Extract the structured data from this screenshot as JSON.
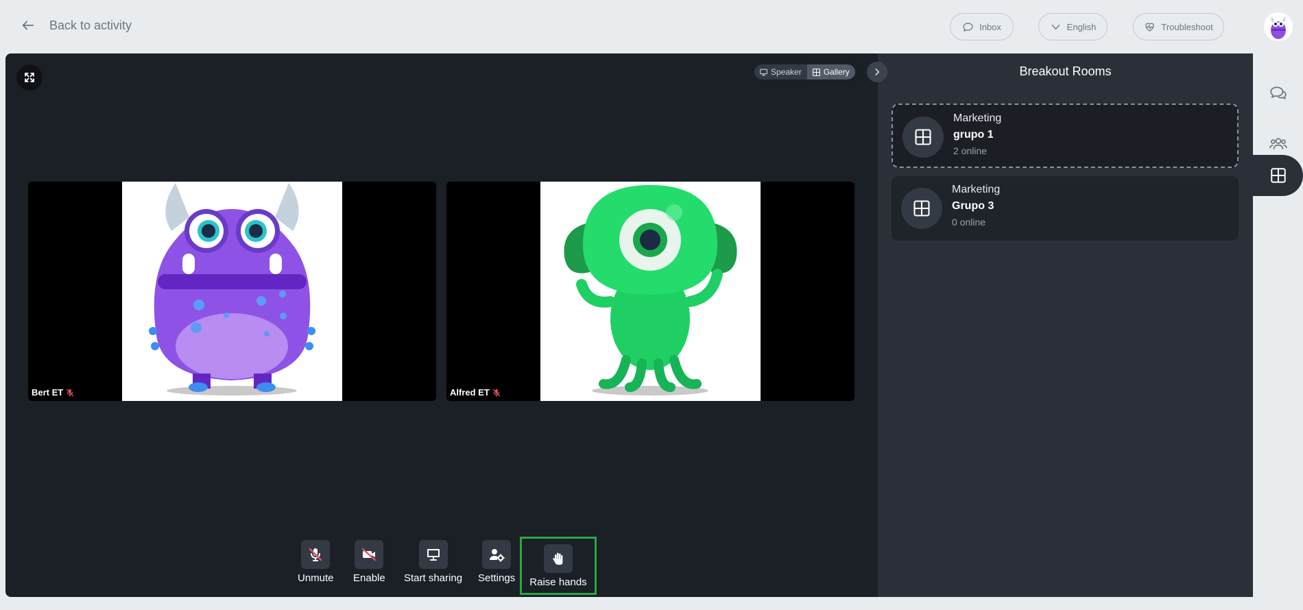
{
  "header": {
    "back_label": "Back to activity",
    "inbox_label": "Inbox",
    "language_label": "English",
    "troubleshoot_label": "Troubleshoot"
  },
  "stage": {
    "view_options": [
      {
        "label": "Speaker",
        "active": false
      },
      {
        "label": "Gallery",
        "active": true
      }
    ],
    "participants": [
      {
        "name": "Bert ET",
        "muted": true,
        "avatar": "purple-monster"
      },
      {
        "name": "Alfred ET",
        "muted": true,
        "avatar": "green-monster"
      }
    ]
  },
  "controls": [
    {
      "label": "Unmute",
      "icon": "mic-off-icon"
    },
    {
      "label": "Enable",
      "icon": "camera-off-icon"
    },
    {
      "label": "Start sharing",
      "icon": "monitor-icon"
    },
    {
      "label": "Settings",
      "icon": "user-gear-icon"
    },
    {
      "label": "Raise hands",
      "icon": "hand-icon",
      "highlighted": true
    }
  ],
  "panel": {
    "title": "Breakout Rooms",
    "rooms": [
      {
        "category": "Marketing",
        "name": "grupo 1",
        "count": "2 online",
        "selected": true
      },
      {
        "category": "Marketing",
        "name": "Grupo 3",
        "count": "0 online",
        "selected": false
      }
    ]
  },
  "theme": {
    "stage_bg": "#1b1f26",
    "panel_bg": "#2b3038",
    "highlight": "#28a745",
    "muted_red": "#e05260"
  }
}
